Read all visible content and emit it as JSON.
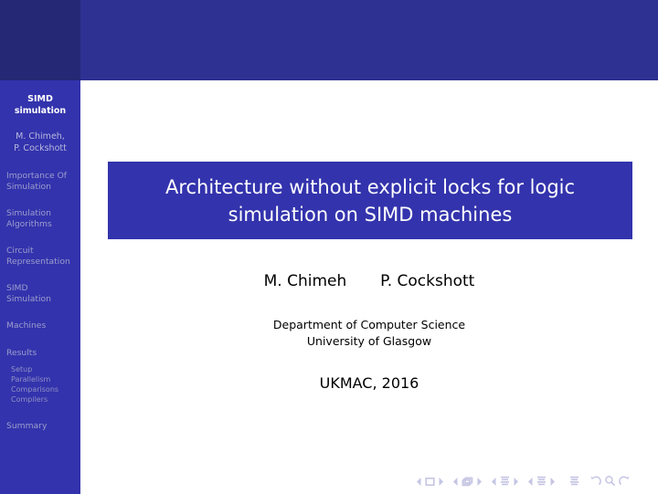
{
  "slide": {
    "sidebar": {
      "title_line1": "SIMD",
      "title_line2": "simulation",
      "authors_line1": "M. Chimeh,",
      "authors_line2": "P. Cockshott",
      "sections": [
        {
          "label_line1": "Importance Of",
          "label_line2": "Simulation"
        },
        {
          "label_line1": "Simulation",
          "label_line2": "Algorithms"
        },
        {
          "label_line1": "Circuit",
          "label_line2": "Representation"
        },
        {
          "label_line1": "SIMD",
          "label_line2": "Simulation"
        },
        {
          "label_line1": "Machines",
          "label_line2": ""
        },
        {
          "label_line1": "Results",
          "label_line2": ""
        },
        {
          "label_line1": "Summary",
          "label_line2": ""
        }
      ],
      "subsections": [
        "Setup",
        "Parallelism",
        "Comparisons",
        "Compilers"
      ]
    },
    "main": {
      "title_line1": "Architecture without explicit locks for logic",
      "title_line2": "simulation on SIMD machines",
      "author1": "M. Chimeh",
      "author2": "P. Cockshott",
      "department": "Department of Computer Science",
      "university": "University of Glasgow",
      "venue": "UKMAC, 2016"
    },
    "navigation": {
      "items": [
        "previous-slide-icon",
        "slide-icon",
        "next-slide-icon",
        "previous-frame-icon",
        "frame-icon",
        "next-frame-icon",
        "previous-subsection-icon",
        "subsection-icon",
        "next-subsection-icon",
        "previous-section-icon",
        "section-icon",
        "next-section-icon",
        "document-icon",
        "back-icon",
        "search-icon",
        "forward-icon"
      ]
    },
    "colors": {
      "header_dark": "#252874",
      "header_blue": "#2e3192",
      "sidebar_blue": "#3333ad",
      "title_text": "#ffffff",
      "sidebar_dim": "#9d9dcd",
      "nav_symbol": "#c5c5e4",
      "body_text": "#000000",
      "background": "#ffffff"
    }
  }
}
